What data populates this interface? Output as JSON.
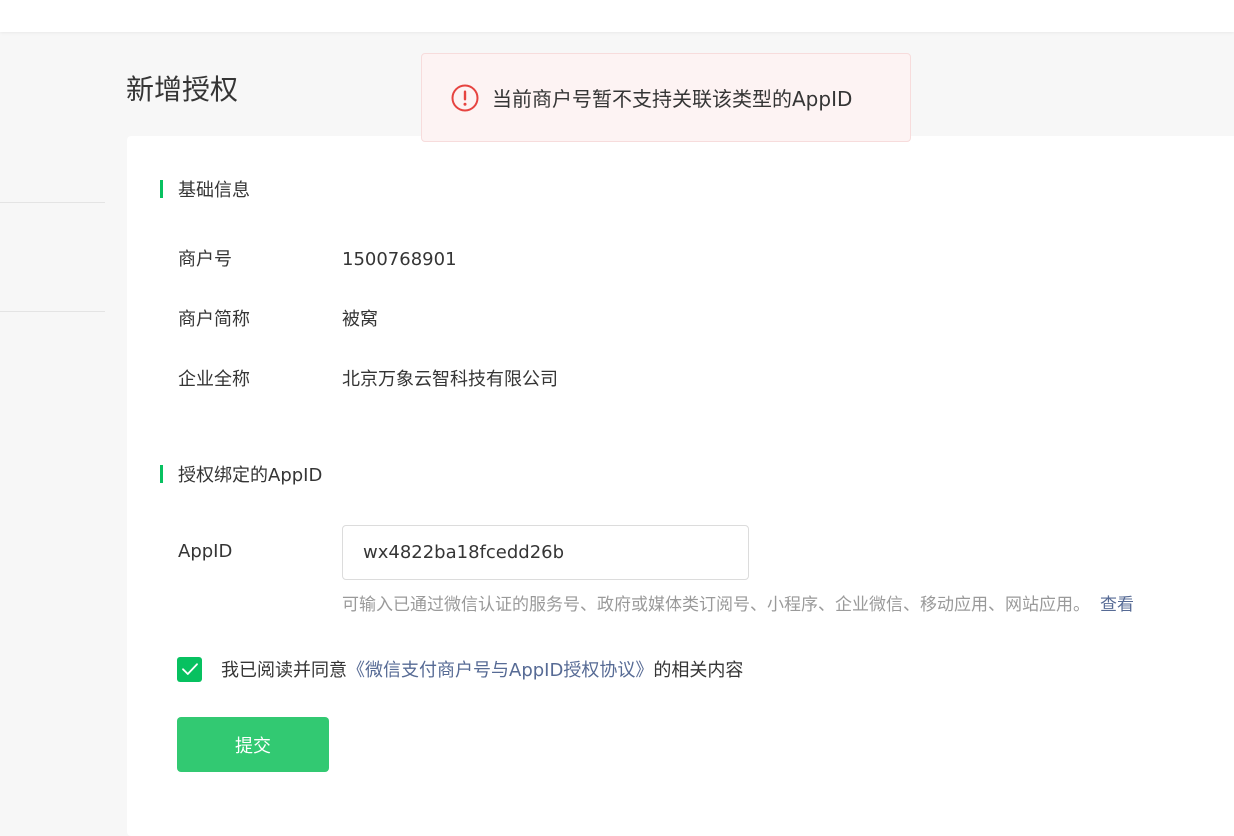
{
  "page": {
    "title": "新增授权"
  },
  "alert": {
    "icon": "exclamation-circle-icon",
    "message": "当前商户号暂不支持关联该类型的AppID",
    "color": "#e64340"
  },
  "basic_info": {
    "section_title": "基础信息",
    "fields": [
      {
        "label": "商户号",
        "value": "1500768901"
      },
      {
        "label": "商户简称",
        "value": "被窝"
      },
      {
        "label": "企业全称",
        "value": "北京万象云智科技有限公司"
      }
    ]
  },
  "appid_section": {
    "section_title": "授权绑定的AppID",
    "label": "AppID",
    "input_value": "wx4822ba18fcedd26b",
    "hint": "可输入已通过微信认证的服务号、政府或媒体类订阅号、小程序、企业微信、移动应用、网站应用。",
    "hint_link": "查看"
  },
  "agreement": {
    "checked": true,
    "prefix": "我已阅读并同意",
    "link": "《微信支付商户号与AppID授权协议》",
    "suffix": "的相关内容"
  },
  "submit": {
    "label": "提交"
  },
  "colors": {
    "accent": "#07c160",
    "button": "#32c972",
    "link": "#576b95"
  }
}
